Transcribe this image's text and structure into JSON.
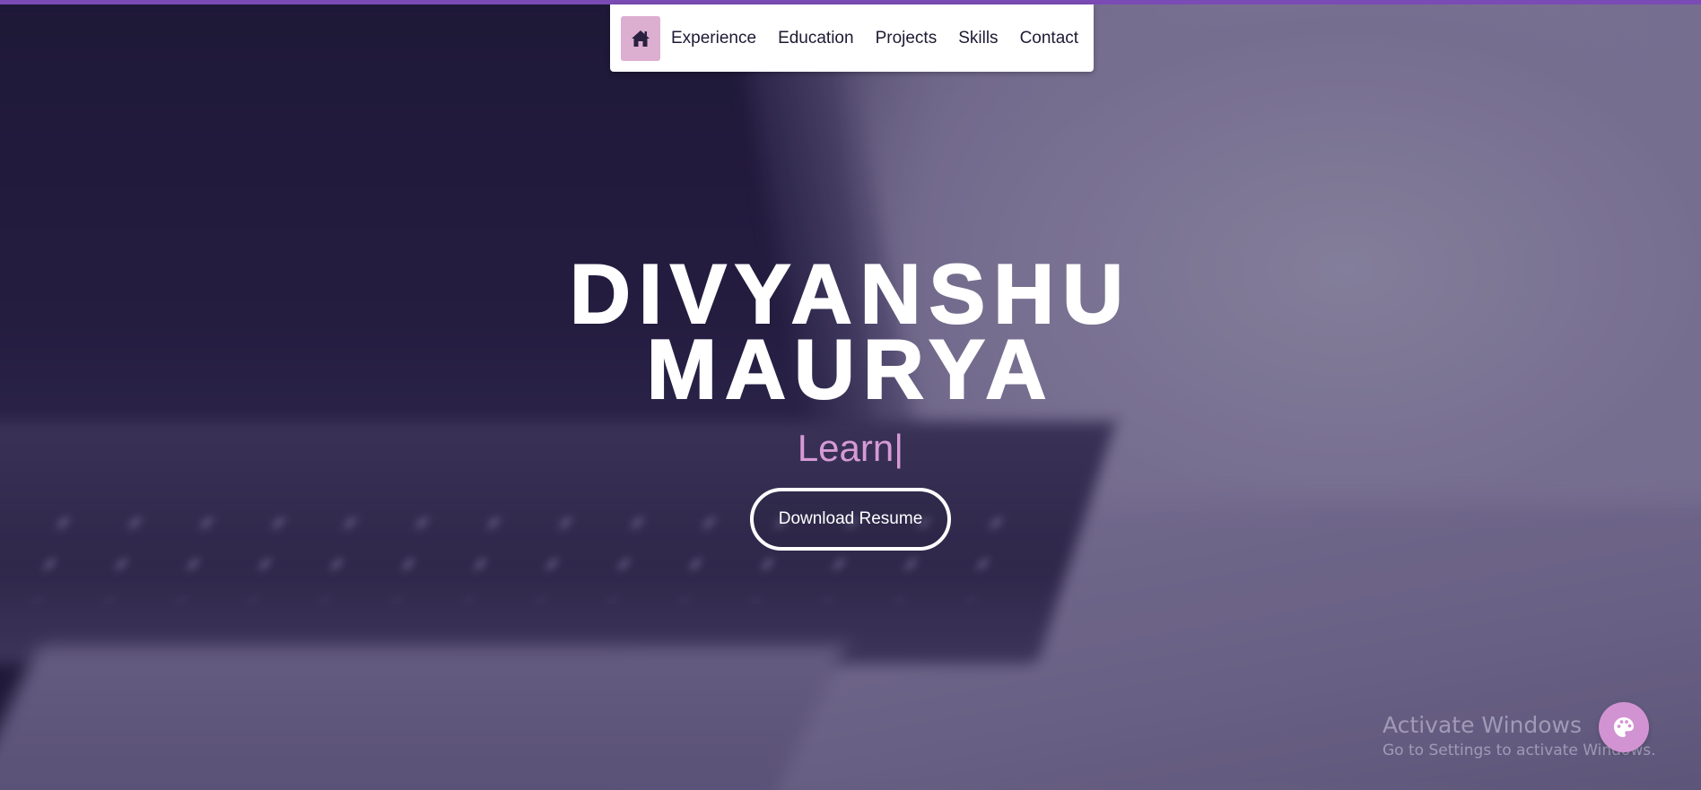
{
  "nav": {
    "home_icon": "home-icon",
    "links": [
      "Experience",
      "Education",
      "Projects",
      "Skills",
      "Contact"
    ]
  },
  "hero": {
    "name_line1": "DIVYANSHU",
    "name_line2": "MAURYA",
    "typed_text": "Learn",
    "typed_cursor": "|",
    "resume_button": "Download Resume"
  },
  "watermark": {
    "title": "Activate Windows",
    "subtitle": "Go to Settings to activate Windows."
  },
  "theme_button_icon": "palette-icon",
  "colors": {
    "accent_bar": "#7b4bb5",
    "home_button_bg": "#dcaed0",
    "typed_text": "#d69ad6",
    "fab_bg": "#d293d3"
  }
}
